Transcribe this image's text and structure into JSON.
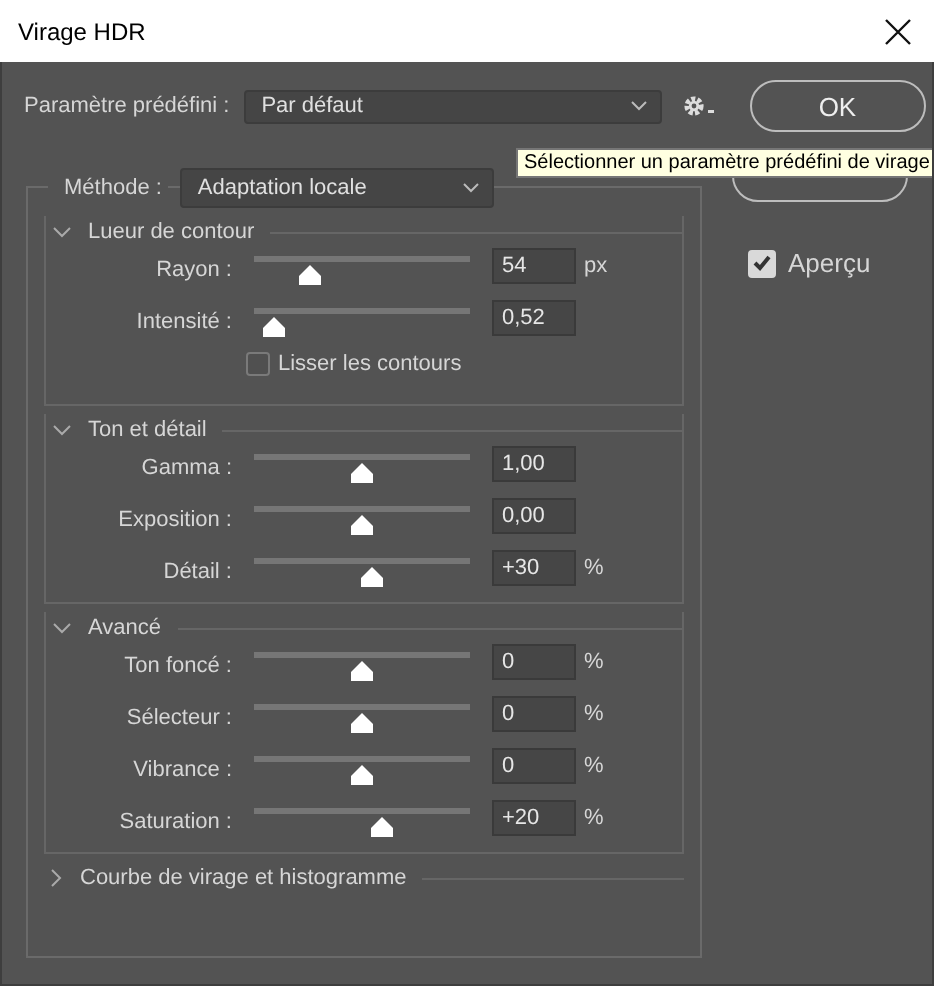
{
  "window": {
    "title": "Virage HDR"
  },
  "preset": {
    "label": "Paramètre prédéfini :",
    "value": "Par défaut"
  },
  "buttons": [
    {
      "label": "OK"
    }
  ],
  "tooltip": "Sélectionner un paramètre prédéfini de virage",
  "preview": {
    "label": "Aperçu",
    "checked": true
  },
  "method": {
    "label": "Méthode :",
    "value": "Adaptation locale"
  },
  "sections": [
    {
      "title": "Lueur de contour",
      "expanded": true,
      "rows": [
        {
          "kind": "slider",
          "label": "Rayon :",
          "level": 0.26,
          "value": "54",
          "unit": "px"
        },
        {
          "kind": "slider",
          "label": "Intensité :",
          "level": 0.09,
          "value": "0,52"
        },
        {
          "kind": "checkbox",
          "label": "Lisser les contours",
          "checked": false
        }
      ]
    },
    {
      "title": "Ton et détail",
      "expanded": true,
      "rows": [
        {
          "kind": "slider",
          "label": "Gamma :",
          "level": 0.5,
          "value": "1,00"
        },
        {
          "kind": "slider",
          "label": "Exposition :",
          "level": 0.5,
          "value": "0,00"
        },
        {
          "kind": "slider",
          "label": "Détail :",
          "level": 0.55,
          "value": "+30",
          "unit": "%"
        }
      ]
    },
    {
      "title": "Avancé",
      "expanded": true,
      "rows": [
        {
          "kind": "slider",
          "label": "Ton foncé :",
          "level": 0.5,
          "value": "0",
          "unit": "%"
        },
        {
          "kind": "slider",
          "label": "Sélecteur :",
          "level": 0.5,
          "value": "0",
          "unit": "%"
        },
        {
          "kind": "slider",
          "label": "Vibrance :",
          "level": 0.5,
          "value": "0",
          "unit": "%"
        },
        {
          "kind": "slider",
          "label": "Saturation :",
          "level": 0.59,
          "value": "+20",
          "unit": "%"
        }
      ]
    },
    {
      "title": "Courbe de virage et histogramme",
      "expanded": false
    }
  ]
}
